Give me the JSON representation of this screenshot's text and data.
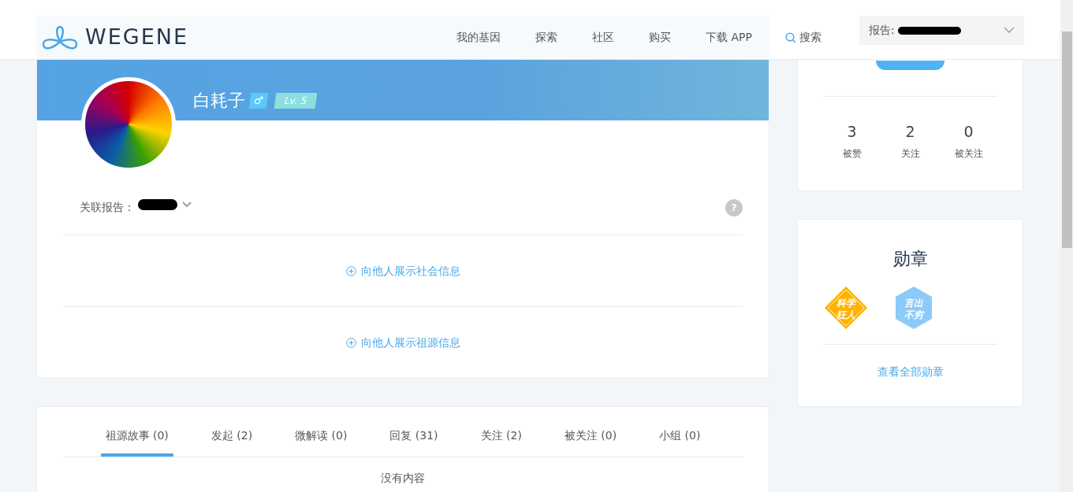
{
  "header": {
    "logo": "WEGENE",
    "nav": [
      "我的基因",
      "探索",
      "社区",
      "购买",
      "下载 APP"
    ],
    "search": "搜索",
    "report_label": "报告:"
  },
  "profile": {
    "name": "白耗子",
    "gender": "♂",
    "level": "Lv. 5",
    "linked_report_label": "关联报告：",
    "help": "?",
    "actions": [
      "向他人展示社会信息",
      "向他人展示祖源信息"
    ]
  },
  "tabs": [
    {
      "label": "祖源故事 (0)",
      "selected": true
    },
    {
      "label": "发起 (2)",
      "selected": false
    },
    {
      "label": "微解读 (0)",
      "selected": false
    },
    {
      "label": "回复 (31)",
      "selected": false
    },
    {
      "label": "关注 (2)",
      "selected": false
    },
    {
      "label": "被关注 (0)",
      "selected": false
    },
    {
      "label": "小组 (0)",
      "selected": false
    }
  ],
  "empty_text": "没有内容",
  "stats": [
    {
      "value": "3",
      "label": "被赞"
    },
    {
      "value": "2",
      "label": "关注"
    },
    {
      "value": "0",
      "label": "被关注"
    }
  ],
  "medals": {
    "title": "勋章",
    "items": [
      {
        "label": "科学狂人",
        "kind": "diamond"
      },
      {
        "label": "言出不穷",
        "kind": "hexagon"
      }
    ],
    "link": "查看全部勋章"
  }
}
